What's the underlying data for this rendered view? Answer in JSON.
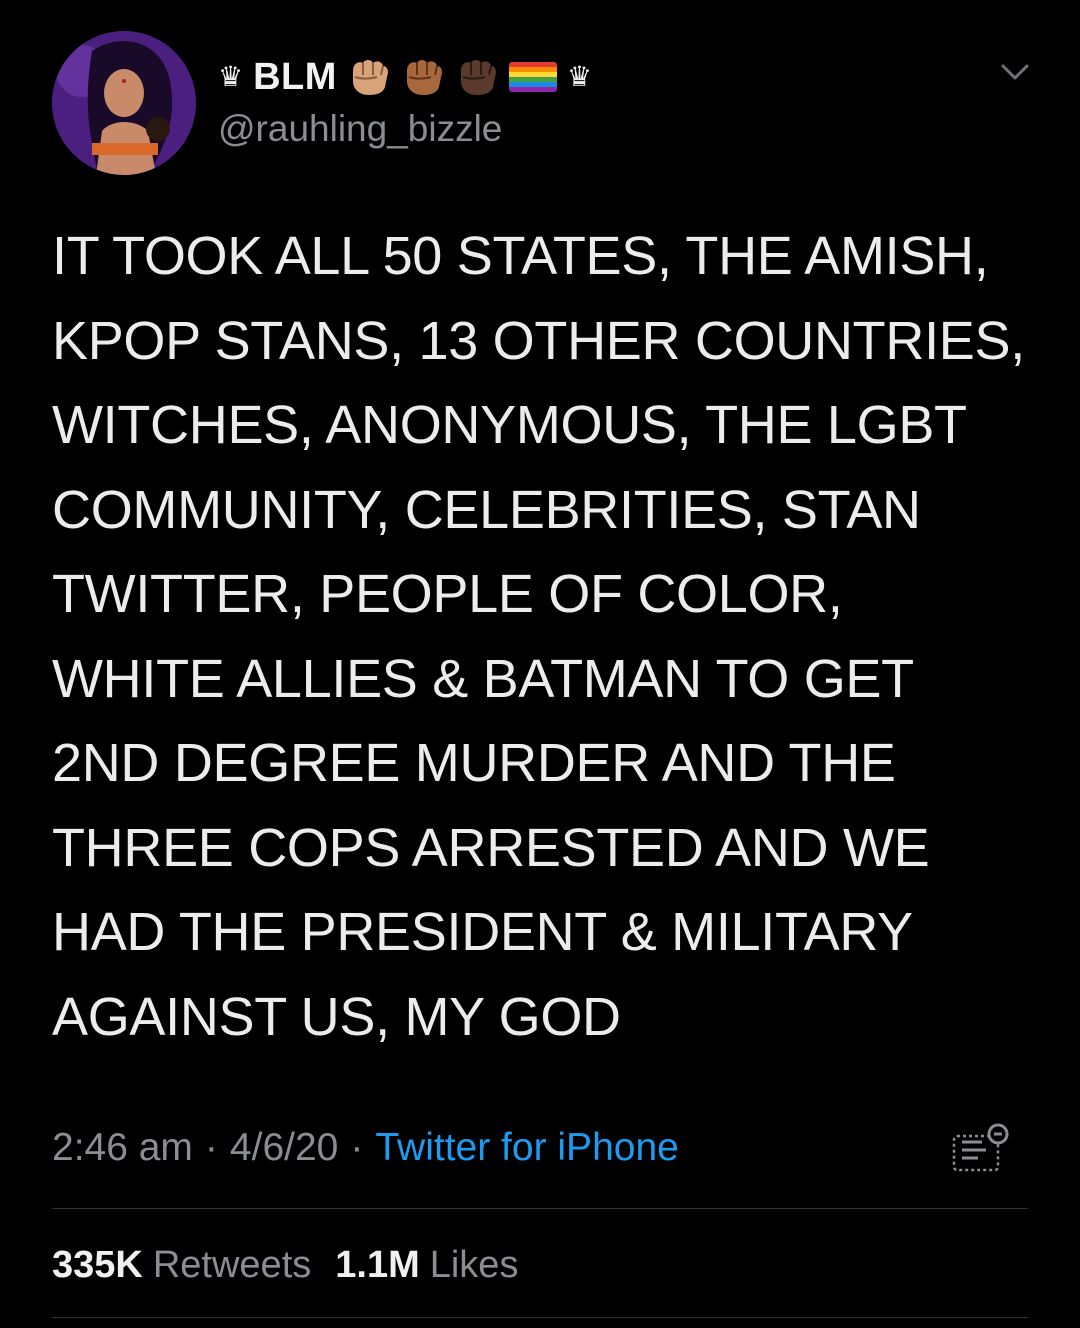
{
  "profile": {
    "display_name": "BLM",
    "crown_symbol": "♛",
    "handle": "@rauhling_bizzle",
    "avatar_icon": "avatar-illustration",
    "emoji_icons": [
      "raised-fist-medium-light",
      "raised-fist-medium",
      "raised-fist-dark",
      "rainbow-flag"
    ]
  },
  "tweet": {
    "lines": [
      "IT TOOK ALL 50 STATES, THE AMISH,",
      "KPOP STANS, 13 OTHER COUNTRIES,",
      "WITCHES, ANONYMOUS, THE LGBT",
      "COMMUNITY, CELEBRITIES, STAN",
      "TWITTER, PEOPLE OF COLOR,",
      "WHITE ALLIES & BATMAN TO GET",
      "2ND DEGREE MURDER AND THE",
      "THREE COPS ARRESTED AND WE",
      "HAD THE PRESIDENT & MILITARY",
      "AGAINST US, MY GOD"
    ]
  },
  "meta": {
    "time": "2:46 am",
    "date": "4/6/20",
    "separator": "·",
    "source": "Twitter for iPhone"
  },
  "stats": {
    "retweets_count": "335K",
    "retweets_label": "Retweets",
    "likes_count": "1.1M",
    "likes_label": "Likes"
  },
  "colors": {
    "background": "#000000",
    "text": "#ececec",
    "secondary": "#8a8d91",
    "link": "#1d9bf0",
    "divider": "#2f3336"
  }
}
